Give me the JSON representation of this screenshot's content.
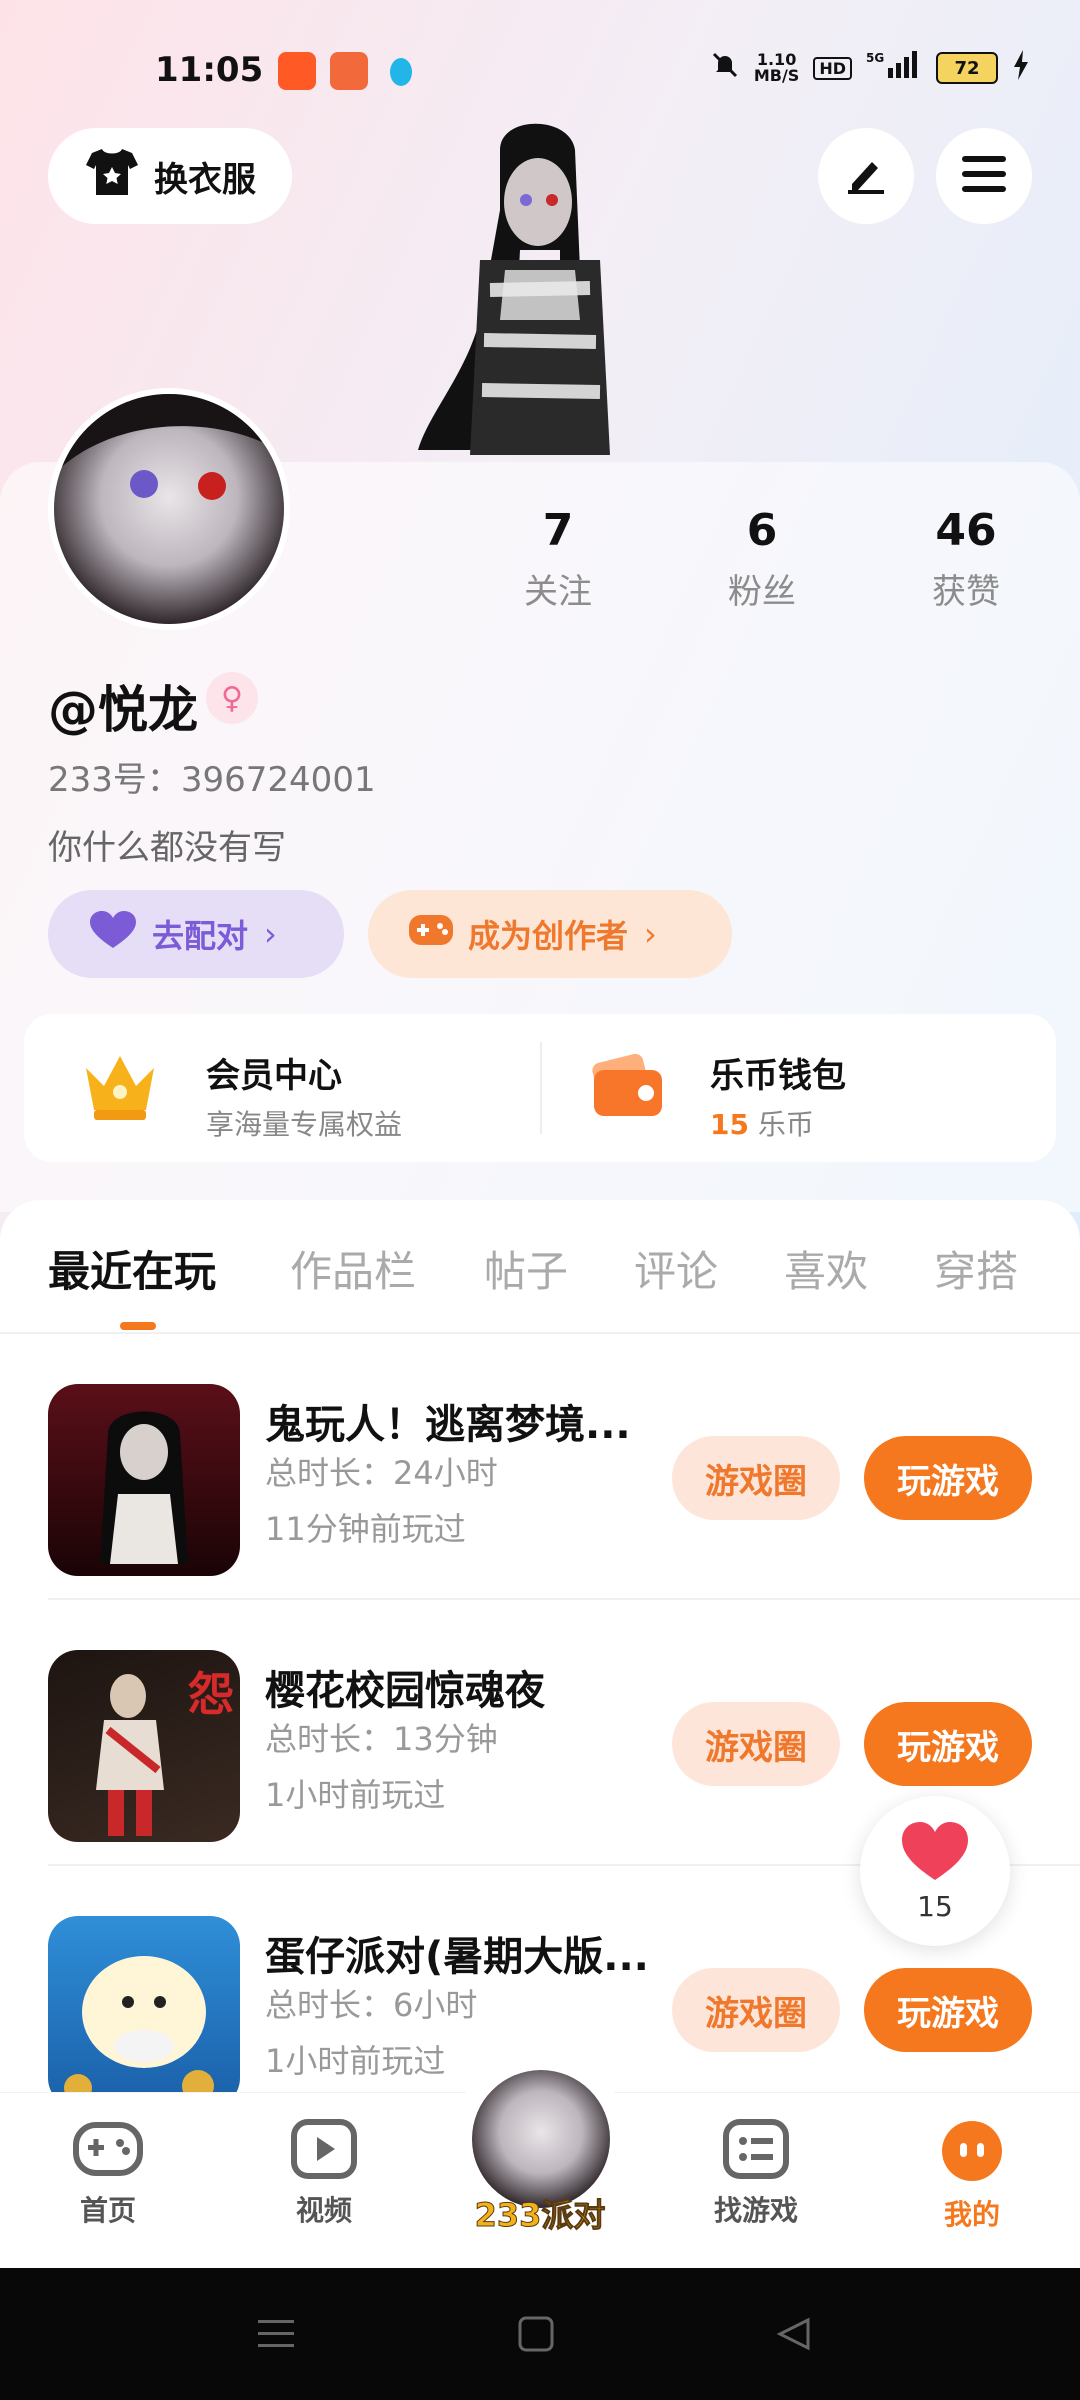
{
  "status_bar": {
    "time": "11:05",
    "net_speed_top": "1.10",
    "net_speed_bottom": "MB/S",
    "hd": "HD",
    "network": "5G",
    "battery": "72"
  },
  "header": {
    "outfit_label": "换衣服"
  },
  "profile": {
    "stats": [
      {
        "num": "7",
        "label": "关注"
      },
      {
        "num": "6",
        "label": "粉丝"
      },
      {
        "num": "46",
        "label": "获赞"
      }
    ],
    "username": "@悦龙",
    "uid": "233号：396724001",
    "bio": "你什么都没有写",
    "match_label": "去配对",
    "creator_label": "成为创作者"
  },
  "vip": {
    "member_title": "会员中心",
    "member_sub": "享海量专属权益",
    "wallet_title": "乐币钱包",
    "wallet_amount": "15",
    "wallet_unit": "乐币"
  },
  "tabs": [
    "最近在玩",
    "作品栏",
    "帖子",
    "评论",
    "喜欢",
    "穿搭"
  ],
  "games": [
    {
      "title": "鬼玩人！逃离梦境...",
      "duration": "总时长：24小时",
      "last_played": "11分钟前玩过",
      "circle": "游戏圈",
      "play": "玩游戏"
    },
    {
      "title": "樱花校园惊魂夜",
      "duration": "总时长：13分钟",
      "last_played": "1小时前玩过",
      "circle": "游戏圈",
      "play": "玩游戏"
    },
    {
      "title": "蛋仔派对(暑期大版...",
      "duration": "总时长：6小时",
      "last_played": "1小时前玩过",
      "circle": "游戏圈",
      "play": "玩游戏"
    }
  ],
  "like_float": {
    "count": "15"
  },
  "bottom_nav": {
    "home": "首页",
    "video": "视频",
    "party": "233派对",
    "find": "找游戏",
    "mine": "我的"
  },
  "colors": {
    "accent": "#f5781e",
    "match_purple": "#7b5bd6"
  }
}
